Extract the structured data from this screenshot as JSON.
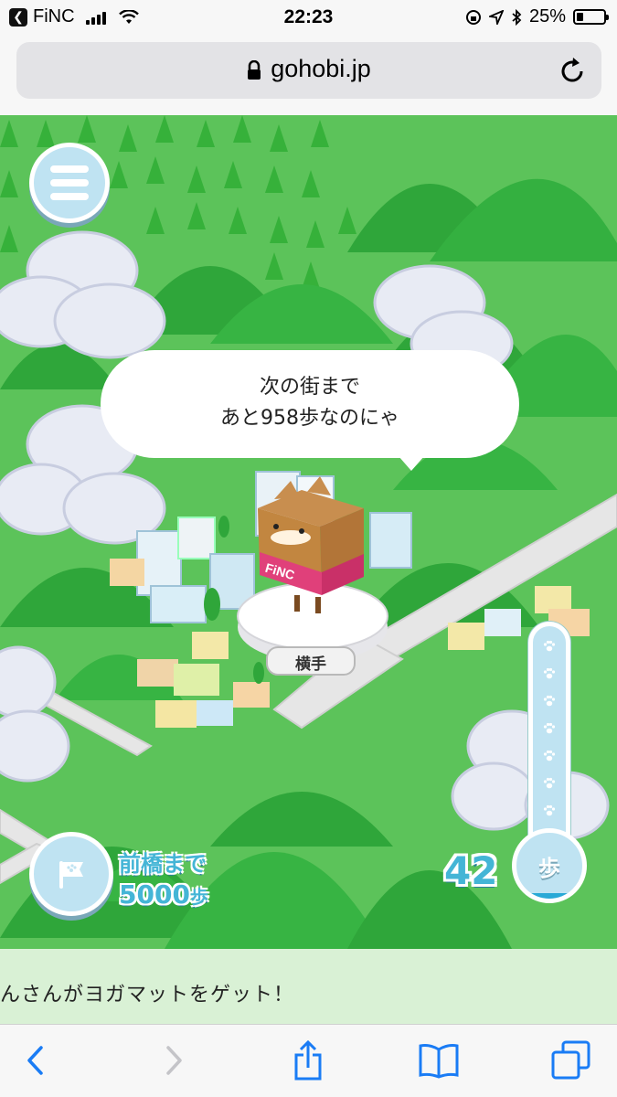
{
  "status_bar": {
    "carrier": "FiNC",
    "time": "22:23",
    "battery": "25%",
    "battery_level": 0.25,
    "icons": [
      "back-to-app-icon",
      "signal-icon",
      "wifi-icon",
      "orientation-lock-icon",
      "location-icon",
      "bluetooth-icon",
      "battery-icon"
    ]
  },
  "browser": {
    "url": "gohobi.jp",
    "icons": [
      "lock-icon",
      "reload-icon"
    ]
  },
  "game": {
    "speech_line1": "次の街まで",
    "speech_line2": "あと958歩なのにゃ",
    "town_label": "横手",
    "character_shirt": "FiNC",
    "destination_label": "前橋まで",
    "destination_steps": "5000",
    "destination_unit": "歩",
    "step_count": "42",
    "step_unit": "歩",
    "step_progress": 0.008,
    "icons": [
      "menu-icon",
      "flag-icon",
      "paw-icon"
    ]
  },
  "banner": {
    "text": "んさんがヨガマットをゲット！"
  },
  "toolbar": {
    "icons": [
      "back-icon",
      "forward-icon",
      "share-icon",
      "bookmarks-icon",
      "tabs-icon"
    ]
  },
  "colors": {
    "accent": "#44b5d6",
    "grass": "#4bb34b",
    "shirt": "#e0407a",
    "ios_blue": "#1a7cf5"
  }
}
